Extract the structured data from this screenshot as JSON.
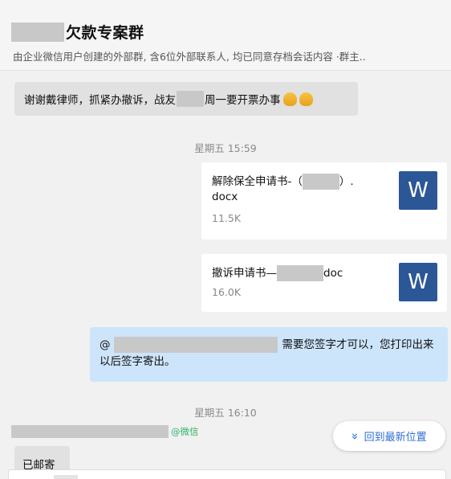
{
  "header": {
    "title": "欠款专案群",
    "subtitle": "由企业微信用户创建的外部群, 含6位外部联系人, 均已同意存档会话内容 ·群主.."
  },
  "chat": {
    "msg1": {
      "text_before": "谢谢戴律师，抓紧办撤诉，战友",
      "text_after": "周一要开票办事"
    },
    "timestamp1": "星期五 15:59",
    "file1": {
      "name_before": "解除保全申请书-（",
      "name_after": "）.",
      "name_ext": "docx",
      "size": "11.5K",
      "icon_letter": "W"
    },
    "file2": {
      "name_before": "撤诉申请书—",
      "name_after": "doc",
      "size": "16.0K",
      "icon_letter": "W"
    },
    "out_msg": {
      "at": "@",
      "text": "需要您签字才可以，您打印出来以后签字寄出。"
    },
    "timestamp2": "星期五 16:10",
    "sender_tag": "@微信",
    "msg2": "已邮寄"
  },
  "jump_button": {
    "label": "回到最新位置",
    "icon": "double-chevron-down-icon"
  },
  "colors": {
    "outgoing_bubble": "#cde5fb",
    "word_icon": "#2b5797",
    "link_blue": "#2f6fd6",
    "wechat_green": "#2fb369"
  }
}
